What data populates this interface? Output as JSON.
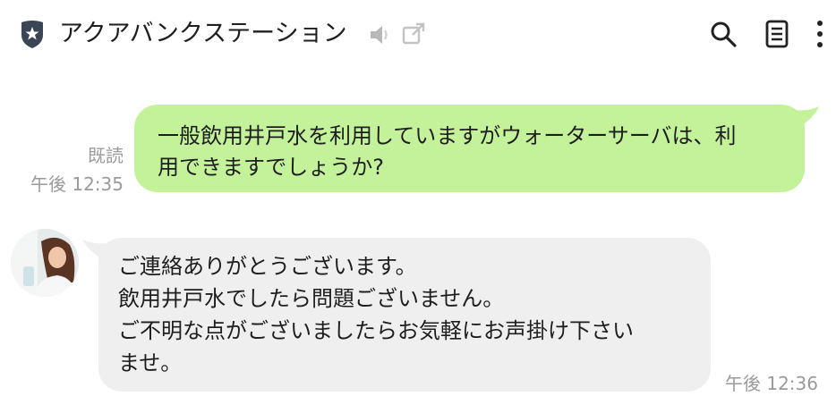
{
  "header": {
    "title": "アクアバンクステーション",
    "icons": {
      "official": "shield-star-icon",
      "mute": "speaker-muted-icon",
      "external": "external-link-icon",
      "search": "search-icon",
      "notes": "notes-icon",
      "more": "more-vertical-icon"
    }
  },
  "messages": {
    "outgoing": {
      "lines": [
        "一般飲用井戸水を利用していますがウォーターサーバは、利",
        "用できますでしょうか?"
      ],
      "read_label": "既読",
      "time": "午後 12:35"
    },
    "incoming": {
      "lines": [
        "ご連絡ありがとうございます。",
        "飲用井戸水でしたら問題ございません。",
        "ご不明な点がございましたらお気軽にお声掛け下さい",
        "ませ。"
      ],
      "time": "午後 12:36"
    }
  },
  "colors": {
    "outgoing_bubble": "#c4f29a",
    "incoming_bubble": "#efefef",
    "meta_text": "#9a9a9a",
    "shield": "#3a4556"
  }
}
